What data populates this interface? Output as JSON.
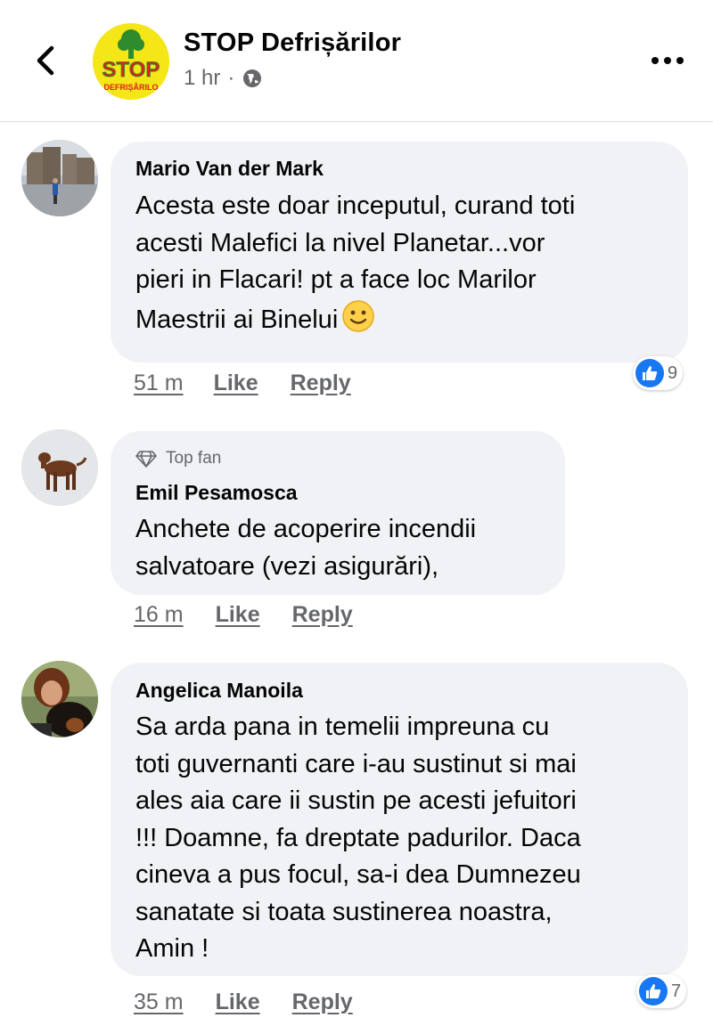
{
  "header": {
    "page_name": "STOP Defrișărilor",
    "time": "1 hr",
    "separator": "·",
    "logo_text_top": "STOP",
    "logo_text_bottom": "DEFRIȘĂRILO"
  },
  "comments": [
    {
      "author": "Mario Van der Mark",
      "text": "Acesta este doar inceputul, curand toti\nacesti Malefici la nivel Planetar...vor\npieri in Flacari! pt a face loc Marilor\nMaestrii ai Binelui",
      "emoji": "slightly-smiling-face",
      "time": "51 m",
      "like": "Like",
      "reply": "Reply",
      "reaction_count": "9"
    },
    {
      "badge": "Top fan",
      "author": "Emil Pesamosca",
      "text": "Anchete de acoperire incendii\nsalvatoare (vezi asigurări),",
      "time": "16 m",
      "like": "Like",
      "reply": "Reply"
    },
    {
      "author": "Angelica Manoila",
      "text": "Sa arda pana in temelii impreuna cu\ntoti guvernanti care i-au sustinut si mai\nales aia care ii sustin pe acesti jefuitori\n!!! Doamne, fa dreptate padurilor. Daca\ncineva a pus focul, sa-i dea Dumnezeu\nsanatate si toata sustinerea noastra,\nAmin !",
      "time": "35 m",
      "like": "Like",
      "reply": "Reply",
      "reaction_count": "7"
    }
  ],
  "colors": {
    "bubble": "#f0f2f5",
    "secondary_text": "#65676b",
    "like_blue": "#1877f2",
    "logo_yellow": "#f5e617",
    "logo_red": "#d9231d",
    "logo_green": "#2e8b2e"
  }
}
